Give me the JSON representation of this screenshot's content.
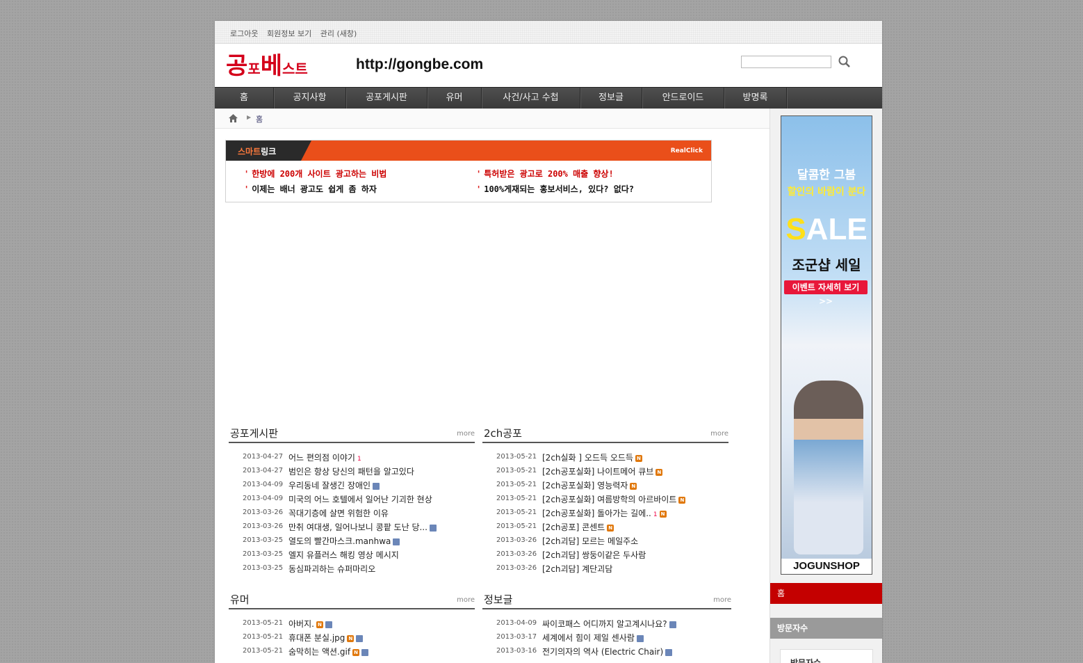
{
  "topbar": {
    "logout": "로그아웃",
    "member_info": "회원정보 보기",
    "admin": "관리 (새창)"
  },
  "header": {
    "logo_big1": "공",
    "logo_small1": "포",
    "logo_big2": "베",
    "logo_small2": "스트",
    "url": "http://gongbe.com"
  },
  "nav": [
    "홈",
    "공지사항",
    "공포게시판",
    "유머",
    "사건/사고 수첩",
    "정보글",
    "안드로이드",
    "방명록"
  ],
  "breadcrumb": {
    "current": "홈"
  },
  "smartlink": {
    "tab_a": "스마트",
    "tab_b": "링크",
    "brand": "RealClick",
    "ads": [
      "한방에 200개 사이트 광고하는 비법",
      "특허받은 광고로 200% 매출 향상!",
      "이제는 배너 광고도 쉽게 좀 하자",
      "100%게재되는 홍보서비스, 있다? 없다?"
    ]
  },
  "boards": [
    {
      "title": "공포게시판",
      "more": "more",
      "items": [
        {
          "date": "2013-04-27",
          "title": "어느 편의점 이야기",
          "count": "1"
        },
        {
          "date": "2013-04-27",
          "title": "범인은 항상 당신의 패턴을 알고있다"
        },
        {
          "date": "2013-04-09",
          "title": "우리동네 잘생긴 장애인",
          "file": true
        },
        {
          "date": "2013-04-09",
          "title": "미국의 어느 호텔에서 일어난 기괴한 현상"
        },
        {
          "date": "2013-03-26",
          "title": "꼭대기층에 살면 위험한 이유"
        },
        {
          "date": "2013-03-26",
          "title": "만취 여대생, 일어나보니 콩팥 도난 당...",
          "file": true
        },
        {
          "date": "2013-03-25",
          "title": "열도의 빨간마스크.manhwa",
          "file": true
        },
        {
          "date": "2013-03-25",
          "title": "엘지 유플러스 해킹 영상 메시지"
        },
        {
          "date": "2013-03-25",
          "title": "동심파괴하는 슈퍼마리오"
        }
      ]
    },
    {
      "title": "2ch공포",
      "more": "more",
      "items": [
        {
          "date": "2013-05-21",
          "title": "[2ch실화 ] 오드득 오드득",
          "new": true
        },
        {
          "date": "2013-05-21",
          "title": "[2ch공포실화] 나이트메어 큐브",
          "new": true
        },
        {
          "date": "2013-05-21",
          "title": "[2ch공포실화] 영능력자",
          "new": true
        },
        {
          "date": "2013-05-21",
          "title": "[2ch공포실화] 여름방학의 아르바이트",
          "new": true
        },
        {
          "date": "2013-05-21",
          "title": "[2ch공포실화] 돌아가는 길에..",
          "count": "1",
          "new": true
        },
        {
          "date": "2013-05-21",
          "title": "[2ch공포] 콘센트",
          "new": true
        },
        {
          "date": "2013-03-26",
          "title": "[2ch괴담] 모르는 메일주소"
        },
        {
          "date": "2013-03-26",
          "title": "[2ch괴담] 쌍둥이같은 두사람"
        },
        {
          "date": "2013-03-26",
          "title": "[2ch괴담] 계단괴담"
        }
      ]
    },
    {
      "title": "유머",
      "more": "more",
      "items": [
        {
          "date": "2013-05-21",
          "title": "아버지.",
          "new": true,
          "file": true
        },
        {
          "date": "2013-05-21",
          "title": "휴대폰 분실.jpg",
          "new": true,
          "file": true
        },
        {
          "date": "2013-05-21",
          "title": "숨막히는 액션.gif",
          "new": true,
          "file": true
        }
      ]
    },
    {
      "title": "정보글",
      "more": "more",
      "items": [
        {
          "date": "2013-04-09",
          "title": "싸이코패스 어디까지 알고계시나요?",
          "file": true
        },
        {
          "date": "2013-03-17",
          "title": "세계에서 힘이 제일 센사람",
          "file": true
        },
        {
          "date": "2013-03-16",
          "title": "전기의자의 역사 (Electric Chair)",
          "file": true
        }
      ]
    }
  ],
  "sidebar": {
    "banner": {
      "line1": "달콤한 그봄",
      "line2": "할인의 바람이 분다",
      "sale_s": "S",
      "sale_rest": "ALE",
      "shop": "조군샵 세일",
      "event": "이벤트 자세히 보기 >>",
      "brand": "JOGUNSHOP"
    },
    "home": "홈",
    "visitor_header": "방문자수",
    "visitor_label": "방문자수"
  }
}
